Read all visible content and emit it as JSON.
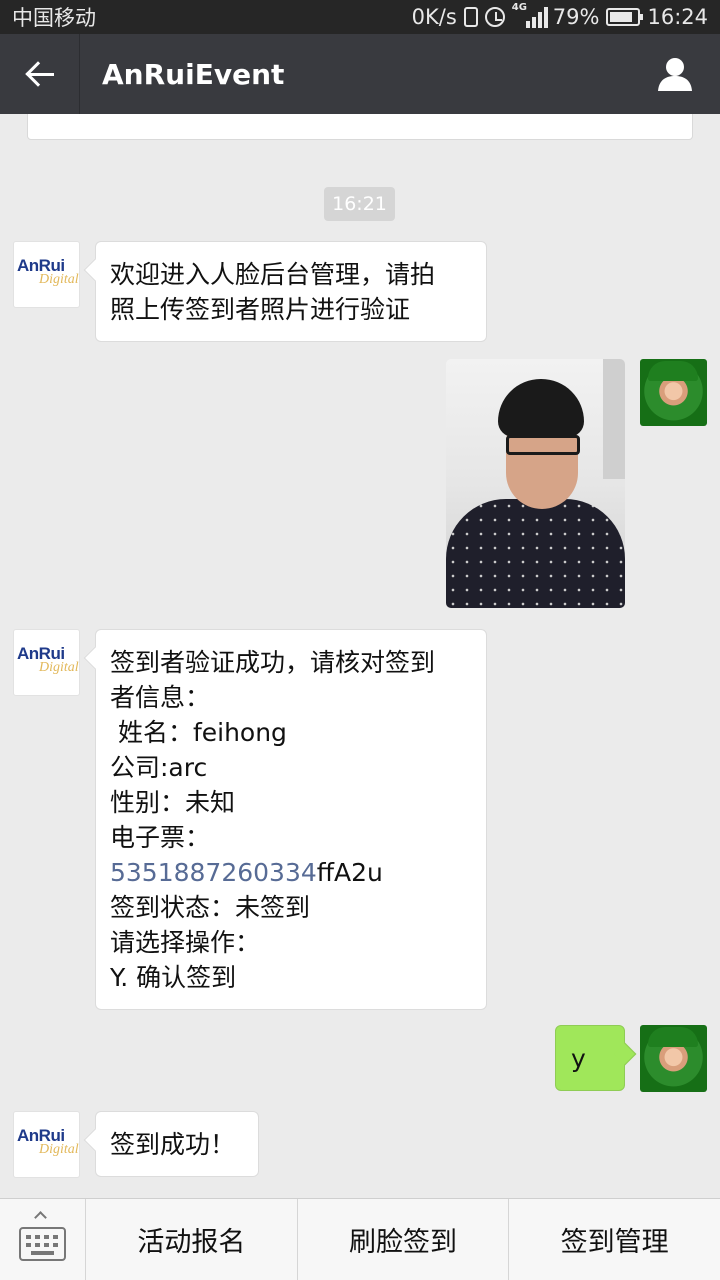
{
  "status_bar": {
    "carrier": "中国移动",
    "net_speed": "0K/s",
    "network_type": "4G",
    "battery": "79%",
    "time": "16:24"
  },
  "header": {
    "title": "AnRuiEvent",
    "back_icon": "back-arrow-icon",
    "profile_icon": "person-icon"
  },
  "bot": {
    "logo_top": "AnRui",
    "logo_bottom": "Digital"
  },
  "chat": {
    "time_divider": "16:21",
    "messages": [
      {
        "from": "bot",
        "lines": [
          "欢迎进入人脸后台管理，请拍",
          "照上传签到者照片进行验证"
        ]
      },
      {
        "from": "user",
        "type": "photo"
      },
      {
        "from": "bot",
        "lines": [
          "签到者验证成功，请核对签到",
          "者信息：",
          " 姓名：feihong",
          "公司:arc",
          "性别：未知",
          "电子票：",
          "签到状态：未签到",
          "请选择操作：",
          "Y. 确认签到"
        ],
        "ticket_link": "5351887260334",
        "ticket_suffix": "ffA2u"
      },
      {
        "from": "user",
        "text": "y"
      },
      {
        "from": "bot",
        "lines": [
          "签到成功！"
        ]
      }
    ]
  },
  "menu": {
    "keyboard_icon": "keyboard-icon",
    "items": [
      "活动报名",
      "刷脸签到",
      "签到管理"
    ]
  },
  "colors": {
    "status_bar": "#262626",
    "title_bar": "#393a3f",
    "chat_bg": "#ebebeb",
    "user_bubble": "#a0e75a",
    "link": "#576b95"
  }
}
